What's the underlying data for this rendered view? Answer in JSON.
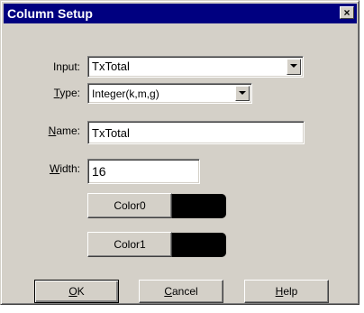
{
  "dialog": {
    "title": "Column Setup",
    "close_label": "×"
  },
  "input": {
    "label": "Input:",
    "value": "TxTotal"
  },
  "type": {
    "label_mnemonic": "T",
    "label_rest": "ype:",
    "value": "Integer(k,m,g)"
  },
  "name": {
    "label_mnemonic": "N",
    "label_rest": "ame:",
    "value": "TxTotal"
  },
  "width": {
    "label_mnemonic": "W",
    "label_rest": "idth:",
    "value": "16"
  },
  "colors": [
    {
      "label": "Color0",
      "swatch": "#000000"
    },
    {
      "label": "Color1",
      "swatch": "#000000"
    }
  ],
  "buttons": {
    "ok_mnemonic": "O",
    "ok_rest": "K",
    "cancel_mnemonic": "C",
    "cancel_rest": "ancel",
    "help_mnemonic": "H",
    "help_rest": "elp"
  },
  "theme": {
    "face": "#d4d0c8",
    "titlebar": "#000080"
  }
}
